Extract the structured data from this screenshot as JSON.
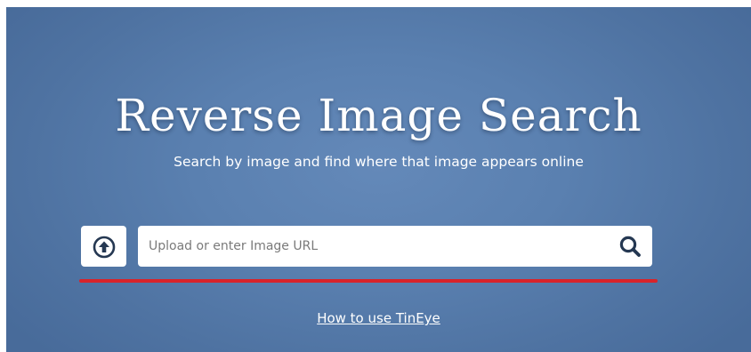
{
  "hero": {
    "title": "Reverse Image Search",
    "subtitle": "Search by image and find where that image appears online"
  },
  "search": {
    "placeholder": "Upload or enter Image URL",
    "value": ""
  },
  "upload_button": {
    "icon": "upload-arrow-circle-icon"
  },
  "search_button": {
    "icon": "magnifier-icon"
  },
  "help": {
    "link_label": "How to use TinEye"
  },
  "colors": {
    "hero_background": "#5a80b0",
    "accent_underline": "#d8232a",
    "icon_dark": "#253852",
    "text_light": "#ffffff"
  }
}
